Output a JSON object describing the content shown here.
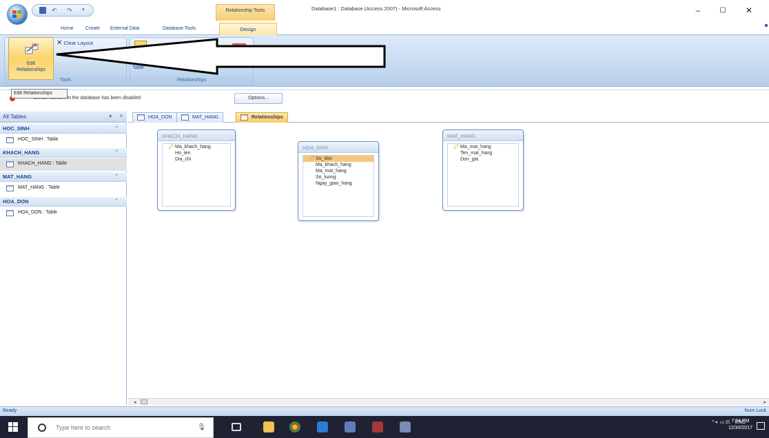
{
  "window": {
    "title": "Database1 : Database (Access 2007) - Microsoft Access",
    "context_tab_title": "Relationship Tools"
  },
  "ribbon": {
    "tabs": [
      "Home",
      "Create",
      "External Data",
      "Database Tools"
    ],
    "active_tab": "Design",
    "tools_group": {
      "label": "Tools",
      "edit_relationships": "Edit\nRelationships",
      "clear_layout": "Clear Layout"
    },
    "relationships_group": {
      "label": "Relationships",
      "show_table": "Table"
    }
  },
  "tooltip": "Edit Relationships",
  "message_bar": {
    "text": "Certain content in the database has been disabled",
    "options": "Options..."
  },
  "nav": {
    "header": "All Tables",
    "groups": [
      {
        "name": "HOC_SINH",
        "item": "HOC_SINH : Table"
      },
      {
        "name": "KHACH_HANG",
        "item": "KHACH_HANG : Table"
      },
      {
        "name": "MAT_HANG",
        "item": "MAT_HANG : Table"
      },
      {
        "name": "HOA_DON",
        "item": "HOA_DON : Table"
      }
    ]
  },
  "doc_tabs": [
    "HOA_DON",
    "MAT_HANG",
    "Relationships"
  ],
  "tables": [
    {
      "name": "KHACH_HANG",
      "fields": [
        "Ma_khach_hang",
        "Ho_ten",
        "Dia_chi"
      ]
    },
    {
      "name": "HOA_DON",
      "fields": [
        "So_don",
        "Ma_khach_hang",
        "Ma_mat_hang",
        "So_luong",
        "Ngay_giao_hang"
      ]
    },
    {
      "name": "MAT_HANG",
      "fields": [
        "Ma_mat_hang",
        "Ten_mat_hang",
        "Don_gia"
      ]
    }
  ],
  "status": {
    "left": "Ready",
    "right": "Num Lock"
  },
  "taskbar": {
    "search_placeholder": "Type here to search",
    "lang": "ENG",
    "time": "7:54 PM",
    "date": "12/30/2017"
  }
}
